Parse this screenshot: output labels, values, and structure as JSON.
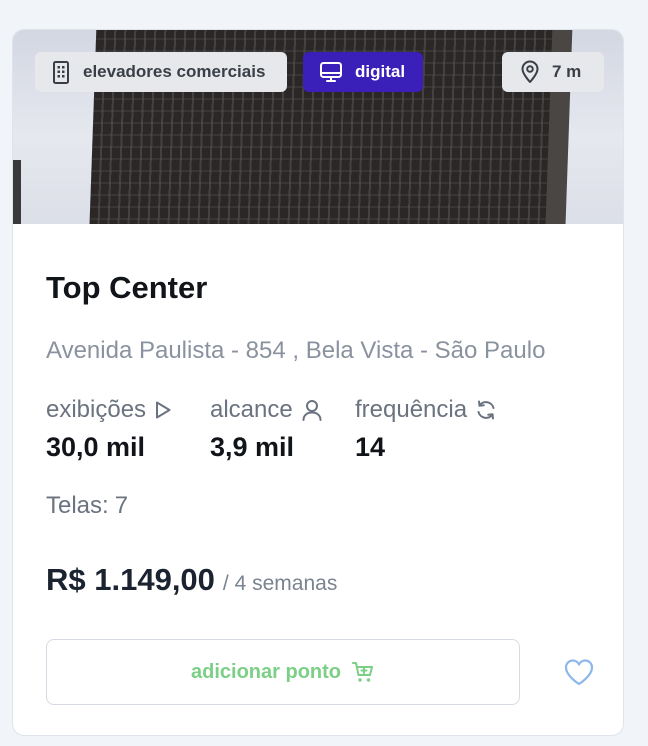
{
  "card": {
    "image_alt": "building facade",
    "badges": {
      "type": {
        "label": "elevadores comerciais",
        "icon": "building-icon"
      },
      "format": {
        "label": "digital",
        "icon": "monitor-icon"
      },
      "distance": {
        "label": "7 m",
        "icon": "location-pin-icon"
      }
    },
    "title": "Top Center",
    "address": "Avenida Paulista - 854 , Bela Vista - São Paulo",
    "metrics": [
      {
        "label": "exibições",
        "value": "30,0 mil",
        "icon": "play-icon"
      },
      {
        "label": "alcance",
        "value": "3,9 mil",
        "icon": "user-icon"
      },
      {
        "label": "frequência",
        "value": "14",
        "icon": "refresh-icon"
      }
    ],
    "screens": {
      "label": "Telas:",
      "value": "7"
    },
    "price": {
      "amount": "R$ 1.149,00",
      "period": "/ 4 semanas"
    },
    "add_button": {
      "label": "adicionar ponto",
      "icon": "cart-icon"
    },
    "favorite": {
      "icon": "heart-icon"
    },
    "colors": {
      "digital_badge": "#3a1fb8",
      "add_button_text": "#7ccf86",
      "heart": "#8bb8e8"
    }
  }
}
